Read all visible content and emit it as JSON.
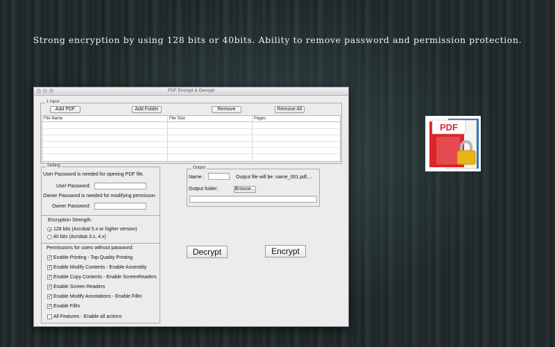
{
  "caption": "Strong encryption by using 128 bits or 40bits. Ability to remove password and permission protection.",
  "window": {
    "title": "PDF Encrypt & Decrypt"
  },
  "input": {
    "legend": "1 Input",
    "buttons": {
      "add_pdf": "Add PDF",
      "add_folder": "Add Folder",
      "remove": "Remove",
      "remove_all": "Remove All"
    },
    "columns": [
      "File Name",
      "File Size",
      "Pages"
    ]
  },
  "setting": {
    "legend": "Setting",
    "user_note": "User Password is needed for opening PDF file.",
    "user_label": "User Password:",
    "owner_note": "Owner Password is needed for modifying permisson",
    "owner_label": "Owner Password:",
    "strength_label": "Encryption Strength:",
    "strength_options": [
      {
        "label": "128 bits (Acrobat 5.x or higher version)",
        "selected": true
      },
      {
        "label": "40 bits (Acrobat 3.x, 4.x)",
        "selected": false
      }
    ],
    "permissions_label": "Permissions for users without password:",
    "permissions": [
      {
        "label": "Enable Printing - Top Quality Printing",
        "checked": true
      },
      {
        "label": "Enable Modify Contents - Enable Assembly",
        "checked": true
      },
      {
        "label": "Enable Copy Contents - Enable ScreenReaders",
        "checked": true
      },
      {
        "label": "Enable Screen Readers",
        "checked": true
      },
      {
        "label": "Enable Modify Annotations - Enable FillIn",
        "checked": true
      },
      {
        "label": "Enable FillIn",
        "checked": true
      },
      {
        "label": "All Features - Enable all actions",
        "checked": false
      }
    ]
  },
  "output": {
    "legend": "Output",
    "name_label": "Name :",
    "name_value": "",
    "file_note": "Output file will be :name_001.pdf,...",
    "folder_label": "Output folder:",
    "browse_label": "Browse...",
    "folder_value": ""
  },
  "actions": {
    "decrypt": "Decrypt",
    "encrypt": "Encrypt"
  },
  "app_icon": {
    "name": "pdf-lock-icon",
    "label": "PDF",
    "accent": "#d9262b",
    "lock_color": "#e8b417"
  },
  "check_glyph": "✓"
}
